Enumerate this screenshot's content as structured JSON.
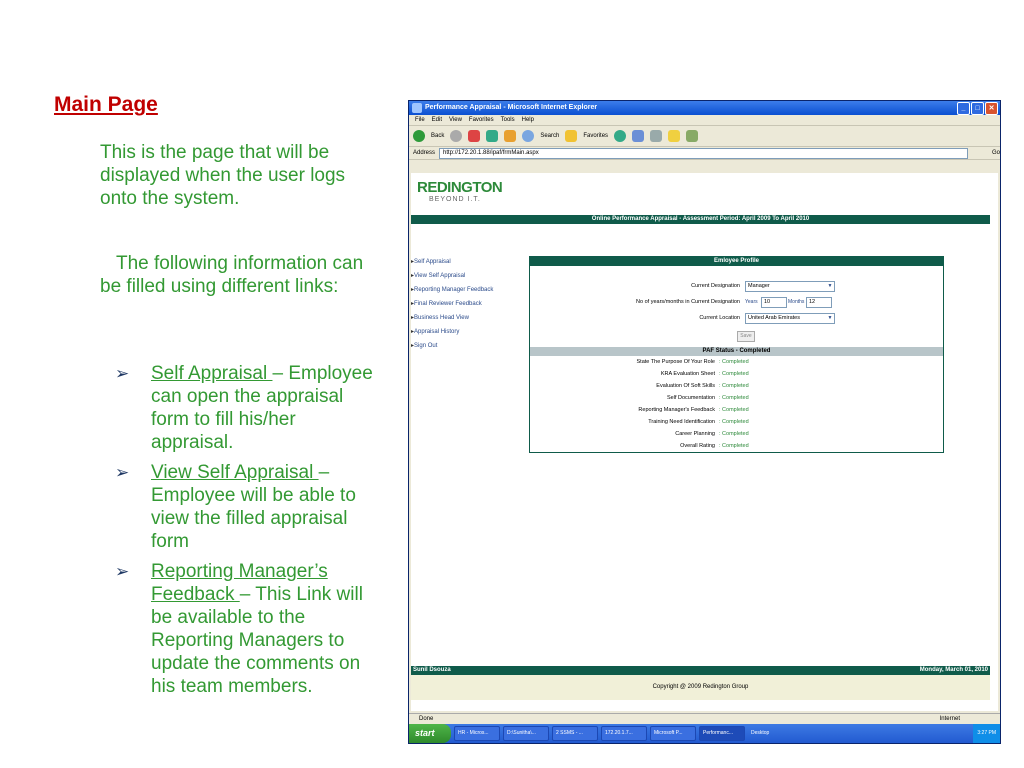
{
  "slide": {
    "title": "Main Page",
    "intro": "This is the page that will be displayed when the user logs onto the system.",
    "intro2": "The following information can be filled using different links:",
    "bullets": [
      {
        "link": "Self Appraisal ",
        "text": "– Employee can open the appraisal form to fill his/her appraisal."
      },
      {
        "link": "View Self Appraisal ",
        "text": "– Employee will be able to view the filled appraisal form"
      },
      {
        "link": "Reporting Manager’s Feedback ",
        "text": "– This Link will be available to the Reporting Managers to update the comments on his team members."
      }
    ]
  },
  "browser": {
    "title": "Performance Appraisal - Microsoft Internet Explorer",
    "menu": [
      "File",
      "Edit",
      "View",
      "Favorites",
      "Tools",
      "Help"
    ],
    "toolbar": {
      "back": "Back",
      "search": "Search",
      "favorites": "Favorites"
    },
    "address_label": "Address",
    "address": "http://172.20.1.88/ipaf/frmMain.aspx",
    "go": "Go",
    "status_left": "Done",
    "status_right": "Internet"
  },
  "app": {
    "logo": "REDINGTON",
    "tagline": "BEYOND I.T.",
    "banner": "Online Performance Appraisal - Assessment Period: April 2009 To April 2010",
    "nav": [
      "Self Appraisal",
      "View Self Appraisal",
      "Reporting Manager Feedback",
      "Final Reviewer Feedback",
      "Business Head View",
      "Appraisal History",
      "Sign Out"
    ],
    "profile": {
      "header": "Emloyee Profile",
      "designation_label": "Current Designation",
      "designation": "Manager",
      "years_label": "No of years/months in Current Designation",
      "years_word": "Years",
      "years": "10",
      "months_word": "Months",
      "months": "12",
      "location_label": "Current Location",
      "location": "United Arab Emirates",
      "save": "Save"
    },
    "paf": {
      "header": "PAF Status - Completed",
      "items": [
        {
          "label": "State The Purpose Of Your Role",
          "value": ": Completed"
        },
        {
          "label": "KRA Evaluation Sheet",
          "value": ": Completed"
        },
        {
          "label": "Evaluation Of Soft Skills",
          "value": ": Completed"
        },
        {
          "label": "Self Documentation",
          "value": ": Completed"
        },
        {
          "label": "Reporting Manager's Feedback",
          "value": ": Completed"
        },
        {
          "label": "Training Need Identification",
          "value": ": Completed"
        },
        {
          "label": "Career Planning",
          "value": ": Completed"
        },
        {
          "label": "Overall Rating",
          "value": ": Completed"
        }
      ]
    },
    "footer_user": "Sunil Dsouza",
    "footer_date": "Monday, March 01, 2010",
    "copyright": "Copyright @ 2009 Redington Group"
  },
  "taskbar": {
    "start": "start",
    "tasks": [
      "HR - Micros...",
      "D:\\Sunitha\\...",
      "2 SSMS - ...",
      "172.20.1.7...",
      "Microsoft P...",
      "Performanc..."
    ],
    "desktop": "Desktop",
    "clock": "3:27 PM"
  }
}
